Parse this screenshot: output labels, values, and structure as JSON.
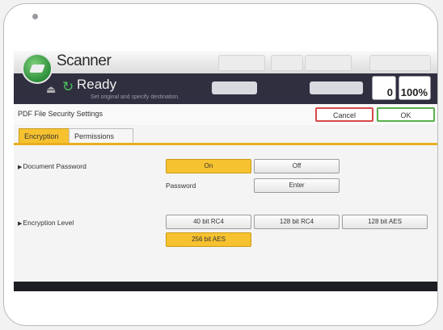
{
  "app": {
    "title": "Scanner"
  },
  "top_buttons": [
    "",
    "",
    "",
    ""
  ],
  "status": {
    "state": "Ready",
    "instruction": "Set original and specify destination.",
    "counter_caption": "",
    "counter_value": "0",
    "memory_caption": "",
    "memory_value": "100%"
  },
  "dialog": {
    "title": "PDF File Security Settings",
    "cancel_label": "Cancel",
    "ok_label": "OK"
  },
  "tabs": [
    {
      "label": "Encryption",
      "active": true
    },
    {
      "label": "Permissions",
      "active": false
    }
  ],
  "document_password": {
    "label": "Document Password",
    "options": [
      "On",
      "Off"
    ],
    "selected": "On",
    "password_label": "Password",
    "enter_label": "Enter"
  },
  "encryption_level": {
    "label": "Encryption Level",
    "options": [
      "40 bit RC4",
      "128 bit RC4",
      "128 bit AES",
      "256 bit AES"
    ],
    "selected": "256 bit AES"
  },
  "colors": {
    "accent": "#f7c230",
    "cancel_border": "#d94848",
    "ok_border": "#58b04c",
    "status_bar": "#2f2f40"
  },
  "icons": {
    "logo": "scanner-logo-icon",
    "ready": "ready-spinner-icon",
    "arrow": "arrow-right-icon"
  }
}
